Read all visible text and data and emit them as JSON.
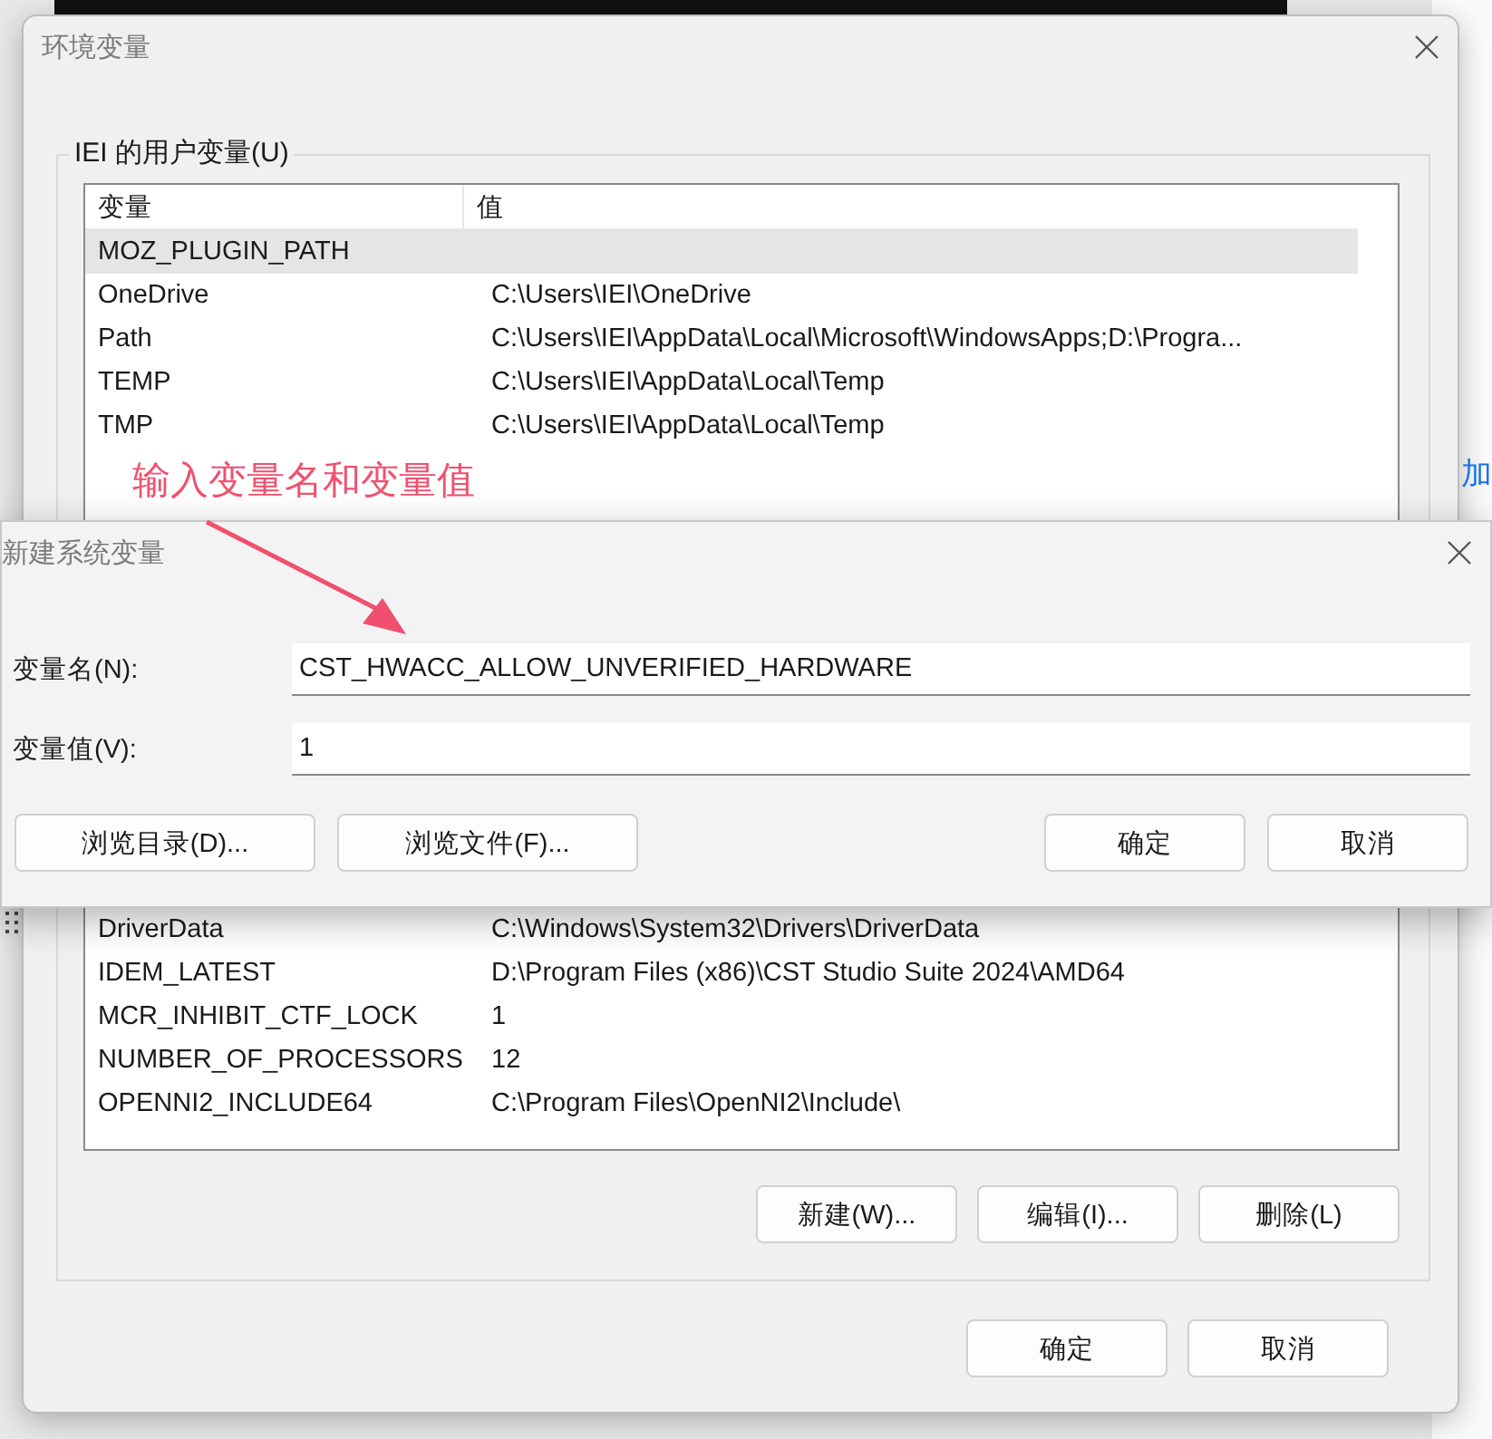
{
  "background": {
    "side_text": "加"
  },
  "main_window": {
    "title": "环境变量",
    "user_group": {
      "label": "IEI 的用户变量(U)",
      "columns": [
        "变量",
        "值"
      ],
      "rows": [
        {
          "name": "MOZ_PLUGIN_PATH",
          "selected": true
        },
        {
          "name": "OneDrive",
          "value": "C:\\Users\\IEI\\OneDrive",
          "selected": false
        },
        {
          "name": "Path",
          "value": "C:\\Users\\IEI\\AppData\\Local\\Microsoft\\WindowsApps;D:\\Progra...",
          "selected": false
        },
        {
          "name": "TEMP",
          "value": "C:\\Users\\IEI\\AppData\\Local\\Temp",
          "selected": false
        },
        {
          "name": "TMP",
          "value": "C:\\Users\\IEI\\AppData\\Local\\Temp",
          "selected": false
        }
      ]
    },
    "system_rows": [
      {
        "name": "DriverData",
        "value": "C:\\Windows\\System32\\Drivers\\DriverData",
        "selected": false
      },
      {
        "name": "IDEM_LATEST",
        "value": "D:\\Program Files (x86)\\CST Studio Suite 2024\\AMD64",
        "selected": false
      },
      {
        "name": "MCR_INHIBIT_CTF_LOCK",
        "value": "1",
        "selected": false
      },
      {
        "name": "NUMBER_OF_PROCESSORS",
        "value": "12",
        "selected": false
      },
      {
        "name": "OPENNI2_INCLUDE64",
        "value": "C:\\Program Files\\OpenNI2\\Include\\",
        "selected": false
      }
    ],
    "system_buttons": [
      "新建(W)...",
      "编辑(I)...",
      "删除(L)"
    ],
    "buttons": [
      "确定",
      "取消"
    ]
  },
  "annotation": {
    "text": "输入变量名和变量值"
  },
  "new_dialog": {
    "title": "新建系统变量",
    "fields": [
      {
        "label": "变量名(N):",
        "value": "CST_HWACC_ALLOW_UNVERIFIED_HARDWARE"
      },
      {
        "label": "变量值(V):",
        "value": "1"
      }
    ],
    "left_buttons": [
      "浏览目录(D)...",
      "浏览文件(F)..."
    ],
    "right_buttons": [
      "确定",
      "取消"
    ]
  }
}
